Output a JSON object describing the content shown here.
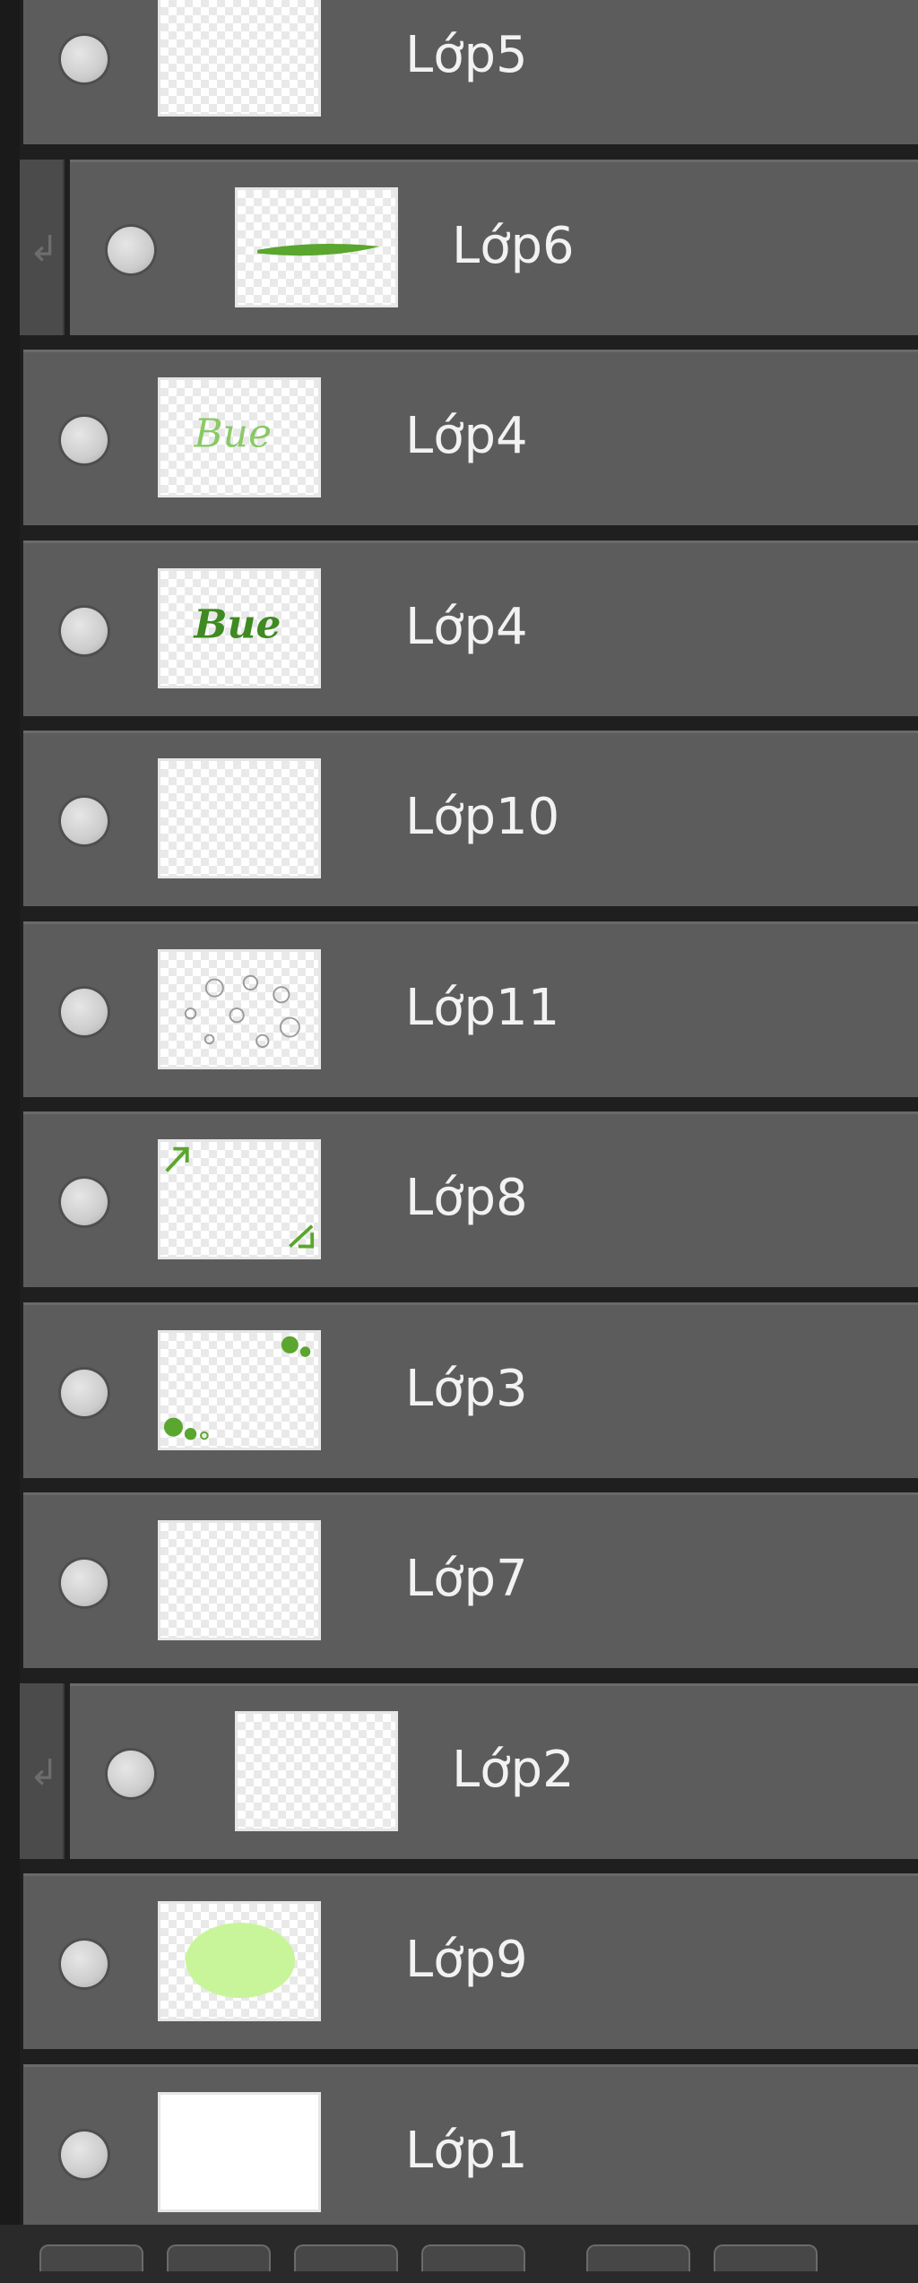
{
  "layers": [
    {
      "name": "Lớp5",
      "clipped": false,
      "thumb": "blank"
    },
    {
      "name": "Lớp6",
      "clipped": true,
      "thumb": "green-stroke"
    },
    {
      "name": "Lớp4",
      "clipped": false,
      "thumb": "script-light"
    },
    {
      "name": "Lớp4",
      "clipped": false,
      "thumb": "script-dark"
    },
    {
      "name": "Lớp10",
      "clipped": false,
      "thumb": "blank"
    },
    {
      "name": "Lớp11",
      "clipped": false,
      "thumb": "bubbles"
    },
    {
      "name": "Lớp8",
      "clipped": false,
      "thumb": "corner-leaves"
    },
    {
      "name": "Lớp3",
      "clipped": false,
      "thumb": "green-dots"
    },
    {
      "name": "Lớp7",
      "clipped": false,
      "thumb": "blank"
    },
    {
      "name": "Lớp2",
      "clipped": true,
      "thumb": "blank"
    },
    {
      "name": "Lớp9",
      "clipped": false,
      "thumb": "green-blob"
    },
    {
      "name": "Lớp1",
      "clipped": false,
      "thumb": "white"
    }
  ],
  "colors": {
    "row_bg": "#5c5c5c",
    "separator": "#111111",
    "label": "#f2f2f2",
    "green_dark": "#5aa62e",
    "green_light": "#c9f59a"
  },
  "icons": {
    "visibility": "eye-dot-icon",
    "clip": "clipping-arrow-icon"
  },
  "toolbar": {
    "button_count": 6
  }
}
